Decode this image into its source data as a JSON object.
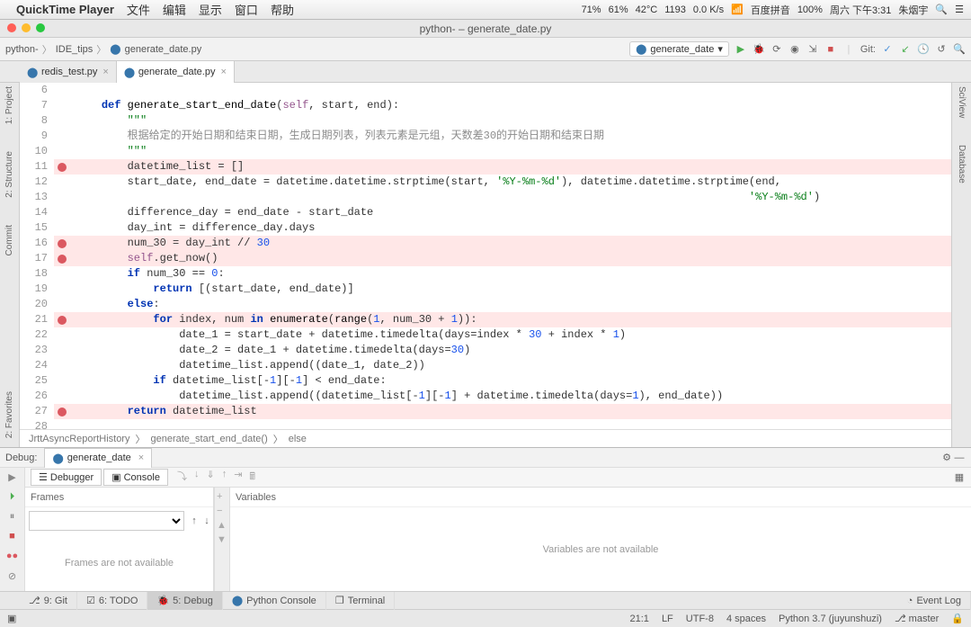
{
  "mac_menu": {
    "app": "QuickTime Player",
    "items": [
      "文件",
      "编辑",
      "显示",
      "窗口",
      "帮助"
    ],
    "status": {
      "cpu1": "71%",
      "cpu2": "61%",
      "temp": "42°C",
      "net_down": "1193",
      "net_up": "0.0 K/s",
      "ime": "百度拼音",
      "battery": "100%",
      "day": "周六 下午3:31",
      "user": "朱烟宇"
    }
  },
  "window_title": "python- – generate_date.py",
  "breadcrumb": {
    "project": "python-",
    "folder": "IDE_tips",
    "file": "generate_date.py"
  },
  "run_config": "generate_date",
  "git_label": "Git:",
  "tabs": [
    {
      "name": "redis_test.py",
      "active": false
    },
    {
      "name": "generate_date.py",
      "active": true
    }
  ],
  "sidebar_left": [
    "1: Project",
    "2: Structure",
    "Commit",
    "2: Favorites"
  ],
  "sidebar_right": [
    "SciView",
    "Database"
  ],
  "code_lines": [
    {
      "n": 6,
      "hl": false,
      "bp": false,
      "html": ""
    },
    {
      "n": 7,
      "hl": false,
      "bp": false,
      "html": "    <span class='kw'>def</span> <span class='fn'>generate_start_end_date</span>(<span class='py-self'>self</span>, start, end):"
    },
    {
      "n": 8,
      "hl": false,
      "bp": false,
      "html": "        <span class='str'>\"\"\"</span>"
    },
    {
      "n": 9,
      "hl": false,
      "bp": false,
      "html": "        <span class='cm'>根据给定的开始日期和结束日期，生成日期列表，列表元素是元组，天数差30的开始日期和结束日期</span>"
    },
    {
      "n": 10,
      "hl": false,
      "bp": false,
      "html": "        <span class='str'>\"\"\"</span>"
    },
    {
      "n": 11,
      "hl": true,
      "bp": true,
      "html": "        datetime_list = []"
    },
    {
      "n": 12,
      "hl": false,
      "bp": false,
      "html": "        start_date, end_date = datetime.datetime.strptime(start, <span class='str'>'%Y-%m-%d'</span>), datetime.datetime.strptime(end,"
    },
    {
      "n": 13,
      "hl": false,
      "bp": false,
      "html": "                                                                                                        <span class='str'>'%Y-%m-%d'</span>)"
    },
    {
      "n": 14,
      "hl": false,
      "bp": false,
      "html": "        difference_day = end_date - start_date"
    },
    {
      "n": 15,
      "hl": false,
      "bp": false,
      "html": "        day_int = difference_day.days"
    },
    {
      "n": 16,
      "hl": true,
      "bp": true,
      "html": "        num_30 = day_int // <span class='num'>30</span>"
    },
    {
      "n": 17,
      "hl": true,
      "bp": true,
      "html": "        <span class='py-self'>self</span>.get_now()"
    },
    {
      "n": 18,
      "hl": false,
      "bp": false,
      "html": "        <span class='kw'>if</span> num_30 == <span class='num'>0</span>:"
    },
    {
      "n": 19,
      "hl": false,
      "bp": false,
      "html": "            <span class='kw'>return</span> [(start_date, end_date)]"
    },
    {
      "n": 20,
      "hl": false,
      "bp": false,
      "html": "        <span class='kw'>else</span>:"
    },
    {
      "n": 21,
      "hl": true,
      "bp": true,
      "html": "            <span class='kw'>for</span> index, num <span class='kw'>in</span> <span class='fn'>enumerate</span>(<span class='fn'>range</span>(<span class='num'>1</span>, num_30 + <span class='num'>1</span>)):"
    },
    {
      "n": 22,
      "hl": false,
      "bp": false,
      "html": "                date_1 = start_date + datetime.timedelta(days=index * <span class='num'>30</span> + index * <span class='num'>1</span>)"
    },
    {
      "n": 23,
      "hl": false,
      "bp": false,
      "html": "                date_2 = date_1 + datetime.timedelta(days=<span class='num'>30</span>)"
    },
    {
      "n": 24,
      "hl": false,
      "bp": false,
      "html": "                datetime_list.append((date_1, date_2))"
    },
    {
      "n": 25,
      "hl": false,
      "bp": false,
      "html": "            <span class='kw'>if</span> datetime_list[-<span class='num'>1</span>][-<span class='num'>1</span>] &lt; end_date:"
    },
    {
      "n": 26,
      "hl": false,
      "bp": false,
      "html": "                datetime_list.append((datetime_list[-<span class='num'>1</span>][-<span class='num'>1</span>] + datetime.timedelta(days=<span class='num'>1</span>), end_date))"
    },
    {
      "n": 27,
      "hl": true,
      "bp": true,
      "html": "        <span class='kw'>return</span> datetime_list"
    },
    {
      "n": 28,
      "hl": false,
      "bp": false,
      "html": ""
    }
  ],
  "editor_crumb": [
    "JrttAsyncReportHistory",
    "generate_start_end_date()",
    "else"
  ],
  "debug": {
    "title": "Debug:",
    "tab": "generate_date",
    "subtabs": {
      "debugger": "Debugger",
      "console": "Console"
    },
    "frames_header": "Frames",
    "frames_msg": "Frames are not available",
    "vars_header": "Variables",
    "vars_msg": "Variables are not available"
  },
  "bottom_tabs": {
    "git": "9: Git",
    "todo": "6: TODO",
    "debug": "5: Debug",
    "pyconsole": "Python Console",
    "terminal": "Terminal",
    "eventlog": "Event Log"
  },
  "status": {
    "pos": "21:1",
    "eol": "LF",
    "enc": "UTF-8",
    "indent": "4 spaces",
    "interp": "Python 3.7 (juyunshuzi)",
    "branch": "master"
  }
}
